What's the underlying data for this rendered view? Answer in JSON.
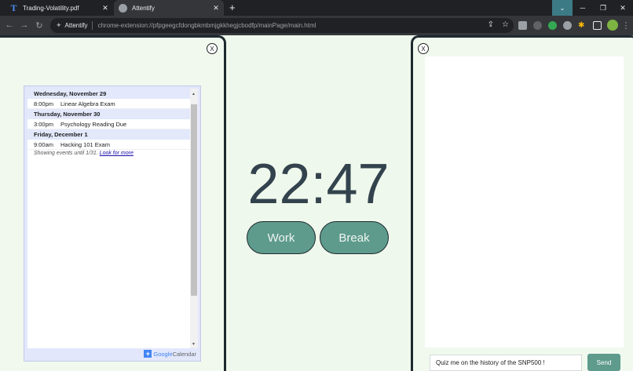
{
  "browser": {
    "tabs": [
      {
        "title": "Trading-Volatility.pdf",
        "favicon": "T",
        "active": false
      },
      {
        "title": "Attentify",
        "favicon": "globe-icon",
        "active": true
      }
    ],
    "address": {
      "site_label": "Attentify",
      "url": "chrome-extension://pfpgeegcfdongbkmbmjgkkhegjcbodfp/mainPage/main.html"
    }
  },
  "calendar": {
    "days": [
      {
        "label": "Wednesday, November 29",
        "events": [
          {
            "time": "8:00pm",
            "title": "Linear Algebra Exam"
          }
        ]
      },
      {
        "label": "Thursday, November 30",
        "events": [
          {
            "time": "3:00pm",
            "title": "Psychology Reading Due"
          }
        ]
      },
      {
        "label": "Friday, December 1",
        "events": [
          {
            "time": "9:00am",
            "title": "Hacking 101 Exam"
          }
        ]
      }
    ],
    "note_prefix": "Showing events until 1/31.",
    "note_link": "Look for more",
    "badge_brand": "Google",
    "badge_product": "Calendar"
  },
  "timer": {
    "display": "22:47",
    "work_label": "Work",
    "break_label": "Break"
  },
  "chat": {
    "input_value": "Quiz me on the history of the SNP500 !",
    "send_label": "Send"
  },
  "close_label": "X",
  "colors": {
    "page_bg": "#eff8ec",
    "accent": "#5e9b8c",
    "timer_text": "#33434e"
  }
}
